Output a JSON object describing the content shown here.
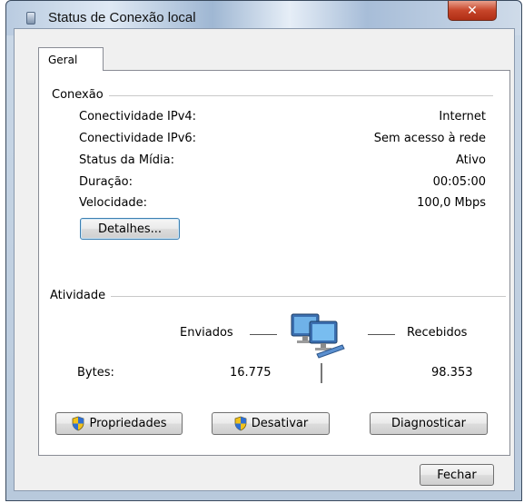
{
  "window": {
    "title": "Status de Conexão local",
    "close_glyph": "✕"
  },
  "tabs": [
    {
      "label": "Geral"
    }
  ],
  "connection": {
    "heading": "Conexão",
    "rows": [
      {
        "label": "Conectividade IPv4:",
        "value": "Internet"
      },
      {
        "label": "Conectividade IPv6:",
        "value": "Sem acesso à rede"
      },
      {
        "label": "Status da Mídia:",
        "value": "Ativo"
      },
      {
        "label": "Duração:",
        "value": "00:05:00"
      },
      {
        "label": "Velocidade:",
        "value": "100,0 Mbps"
      }
    ],
    "details_button": "Detalhes..."
  },
  "activity": {
    "heading": "Atividade",
    "sent_label": "Enviados",
    "received_label": "Recebidos",
    "bytes_label": "Bytes:",
    "bytes_sent": "16.775",
    "bytes_received": "98.353"
  },
  "buttons": {
    "properties": "Propriedades",
    "disable": "Desativar",
    "diagnose": "Diagnosticar",
    "close": "Fechar"
  },
  "icons": {
    "title": "network-adapter-icon",
    "activity": "network-computers-icon",
    "shield": "uac-shield-icon"
  }
}
